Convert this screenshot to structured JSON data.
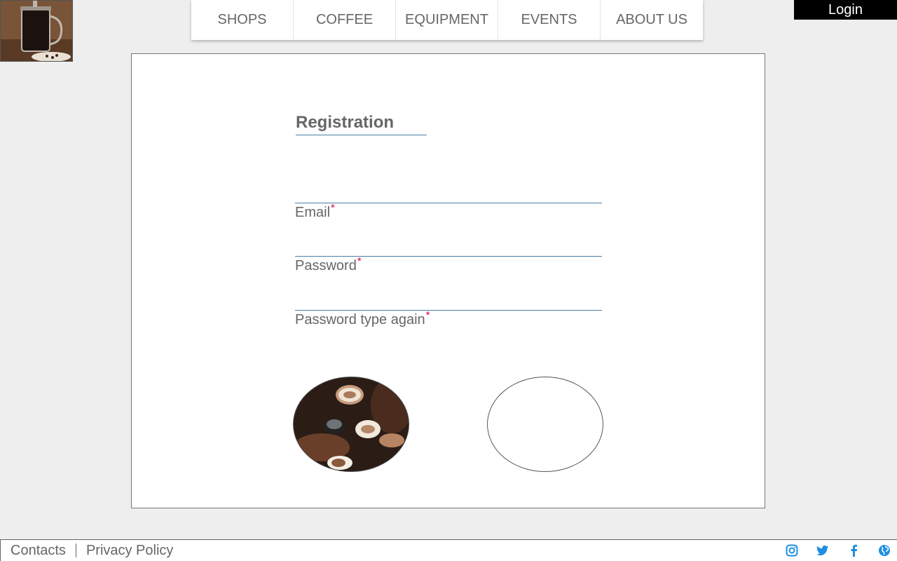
{
  "nav": {
    "items": [
      {
        "label": "SHOPS"
      },
      {
        "label": "COFFEE"
      },
      {
        "label": "EQUIPMENT"
      },
      {
        "label": "EVENTS"
      },
      {
        "label": "ABOUT US"
      }
    ]
  },
  "header": {
    "login_label": "Login"
  },
  "form": {
    "title": "Registration",
    "fields": [
      {
        "label": "Email",
        "required": "*"
      },
      {
        "label": "Password",
        "required": "*"
      },
      {
        "label": "Password type again",
        "required": "*"
      }
    ]
  },
  "footer": {
    "links": [
      {
        "label": "Contacts"
      },
      {
        "label": "Privacy Policy"
      }
    ],
    "socials": [
      "instagram-icon",
      "twitter-icon",
      "facebook-icon",
      "globe-icon"
    ]
  },
  "colors": {
    "accent_line": "#4a7fa8",
    "required_star": "#e0004f",
    "social_blue": "#1d8fe1"
  }
}
